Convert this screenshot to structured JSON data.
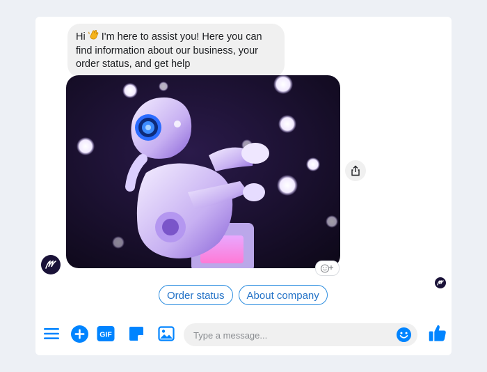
{
  "message": {
    "line1_a": "Hi",
    "line1_b": "I'm here to assist you! Here you can",
    "line2": "find information about our business, your",
    "line3": "order status, and get help",
    "emoji": "waving-hand"
  },
  "attachment": {
    "image": "robot-photo"
  },
  "quick_replies": [
    {
      "label": "Order status"
    },
    {
      "label": "About company"
    }
  ],
  "composer": {
    "placeholder": "Type a message...",
    "value": ""
  },
  "icons": {
    "menu": "hamburger-menu-icon",
    "add": "plus-circle-icon",
    "gif": "GIF",
    "sticker": "sticker-icon",
    "image": "image-icon",
    "emoji": "smiley-icon",
    "like": "thumbs-up-icon",
    "share": "share-icon",
    "react": "add-reaction-icon"
  },
  "colors": {
    "accent": "#0084ff",
    "bubble": "#f0f0f0",
    "background": "#edf0f5"
  }
}
